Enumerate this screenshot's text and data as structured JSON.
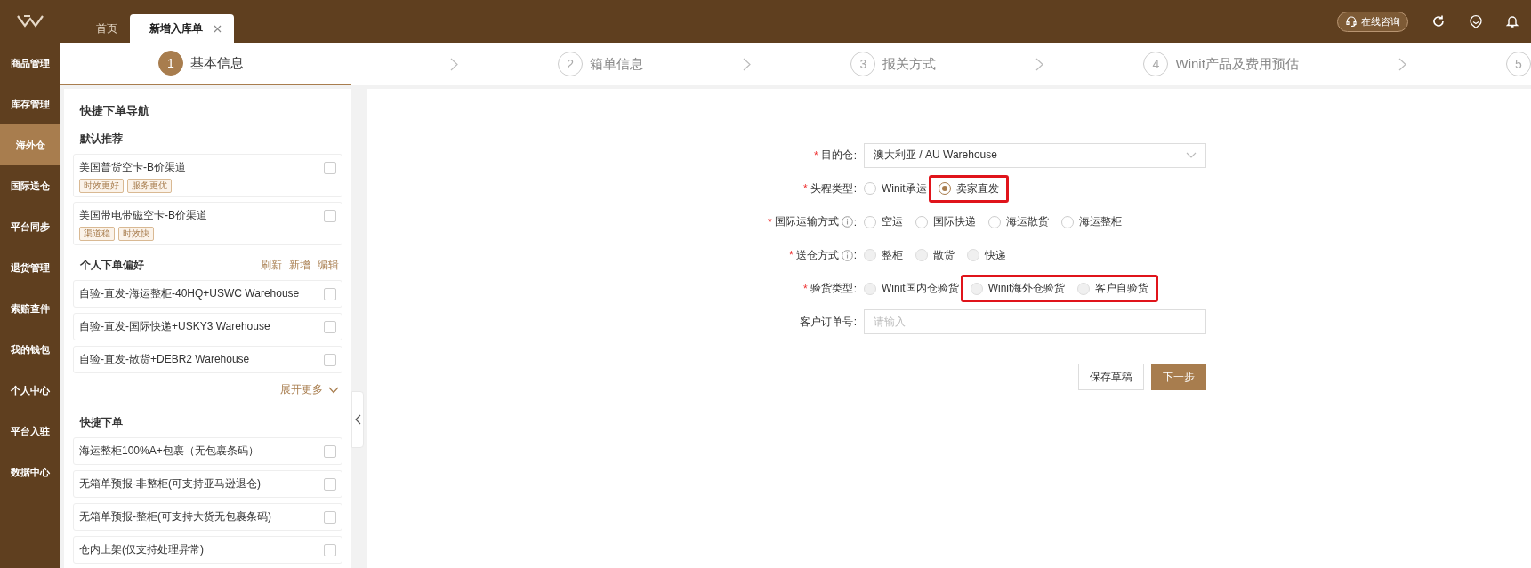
{
  "sidebar": {
    "items": [
      {
        "label": "商品管理",
        "selected": false
      },
      {
        "label": "库存管理",
        "selected": false
      },
      {
        "label": "海外仓",
        "selected": true
      },
      {
        "label": "国际送仓",
        "selected": false
      },
      {
        "label": "平台同步",
        "selected": false
      },
      {
        "label": "退货管理",
        "selected": false
      },
      {
        "label": "索赔查件",
        "selected": false
      },
      {
        "label": "我的钱包",
        "selected": false
      },
      {
        "label": "个人中心",
        "selected": false
      },
      {
        "label": "平台入驻",
        "selected": false
      },
      {
        "label": "数据中心",
        "selected": false
      }
    ]
  },
  "tabs": [
    {
      "label": "首页",
      "selected": false,
      "closable": false
    },
    {
      "label": "新增入库单",
      "selected": true,
      "closable": true
    }
  ],
  "header": {
    "consult_button": "在线咨询"
  },
  "steps": [
    {
      "number": "1",
      "label": "基本信息",
      "active": true
    },
    {
      "number": "2",
      "label": "箱单信息",
      "active": false
    },
    {
      "number": "3",
      "label": "报关方式",
      "active": false
    },
    {
      "number": "4",
      "label": "Winit产品及费用预估",
      "active": false
    },
    {
      "number": "5",
      "active": false
    }
  ],
  "quick_nav": {
    "title": "快捷下单导航",
    "recommended": {
      "title": "默认推荐",
      "items": [
        {
          "name": "美国普货空卡-B价渠道",
          "tags": [
            "时效更好",
            "服务更优"
          ],
          "checked": false
        },
        {
          "name": "美国带电带磁空卡-B价渠道",
          "tags": [
            "渠道稳",
            "时效快"
          ],
          "checked": false
        }
      ]
    },
    "preferences": {
      "title": "个人下单偏好",
      "actions": [
        "刷新",
        "新增",
        "编辑"
      ],
      "items": [
        {
          "name": "自验-直发-海运整柜-40HQ+USWC Warehouse",
          "checked": false
        },
        {
          "name": "自验-直发-国际快递+USKY3 Warehouse",
          "checked": false
        },
        {
          "name": "自验-直发-散货+DEBR2 Warehouse",
          "checked": false
        }
      ],
      "expand": "展开更多"
    },
    "quick_order": {
      "title": "快捷下单",
      "items": [
        {
          "name": "海运整柜100%A+包裹（无包裹条码）",
          "checked": false
        },
        {
          "name": "无箱单预报-非整柜(可支持亚马逊退仓)",
          "checked": false
        },
        {
          "name": "无箱单预报-整柜(可支持大货无包裹条码)",
          "checked": false
        },
        {
          "name": "仓内上架(仅支持处理异常)",
          "checked": false
        }
      ]
    }
  },
  "form": {
    "fields": [
      {
        "kind": "select",
        "required_mark": "*",
        "label": "目的仓",
        "suffix": ":",
        "value": "澳大利亚 / AU Warehouse"
      },
      {
        "kind": "radio",
        "required_mark": "*",
        "label": "头程类型",
        "suffix": ":",
        "options": [
          {
            "label": "Winit承运",
            "selected": false,
            "disabled": false,
            "annotated": false
          },
          {
            "label": "卖家直发",
            "selected": true,
            "disabled": false,
            "annotated": true
          }
        ]
      },
      {
        "kind": "radio",
        "required_mark": "*",
        "label": "国际运输方式",
        "suffix": ":",
        "info": true,
        "options": [
          {
            "label": "空运",
            "selected": false,
            "disabled": false,
            "annotated": false
          },
          {
            "label": "国际快递",
            "selected": false,
            "disabled": false,
            "annotated": false
          },
          {
            "label": "海运散货",
            "selected": false,
            "disabled": false,
            "annotated": false
          },
          {
            "label": "海运整柜",
            "selected": false,
            "disabled": false,
            "annotated": false
          }
        ]
      },
      {
        "kind": "radio",
        "required_mark": "*",
        "label": "送仓方式",
        "suffix": ":",
        "info": true,
        "options": [
          {
            "label": "整柜",
            "selected": false,
            "disabled": true,
            "annotated": false
          },
          {
            "label": "散货",
            "selected": false,
            "disabled": true,
            "annotated": false
          },
          {
            "label": "快递",
            "selected": false,
            "disabled": true,
            "annotated": false
          }
        ]
      },
      {
        "kind": "radio",
        "required_mark": "*",
        "label": "验货类型",
        "suffix": ":",
        "options": [
          {
            "label": "Winit国内仓验货",
            "selected": false,
            "disabled": true,
            "annotated": false
          },
          {
            "label": "Winit海外仓验货",
            "selected": false,
            "disabled": true,
            "annotated": true
          },
          {
            "label": "客户自验货",
            "selected": false,
            "disabled": true,
            "annotated": true
          }
        ]
      },
      {
        "kind": "input",
        "label": "客户订单号",
        "suffix": ":",
        "placeholder": "请输入"
      }
    ],
    "buttons": [
      {
        "label": "保存草稿",
        "primary": false
      },
      {
        "label": "下一步",
        "primary": true
      }
    ]
  }
}
